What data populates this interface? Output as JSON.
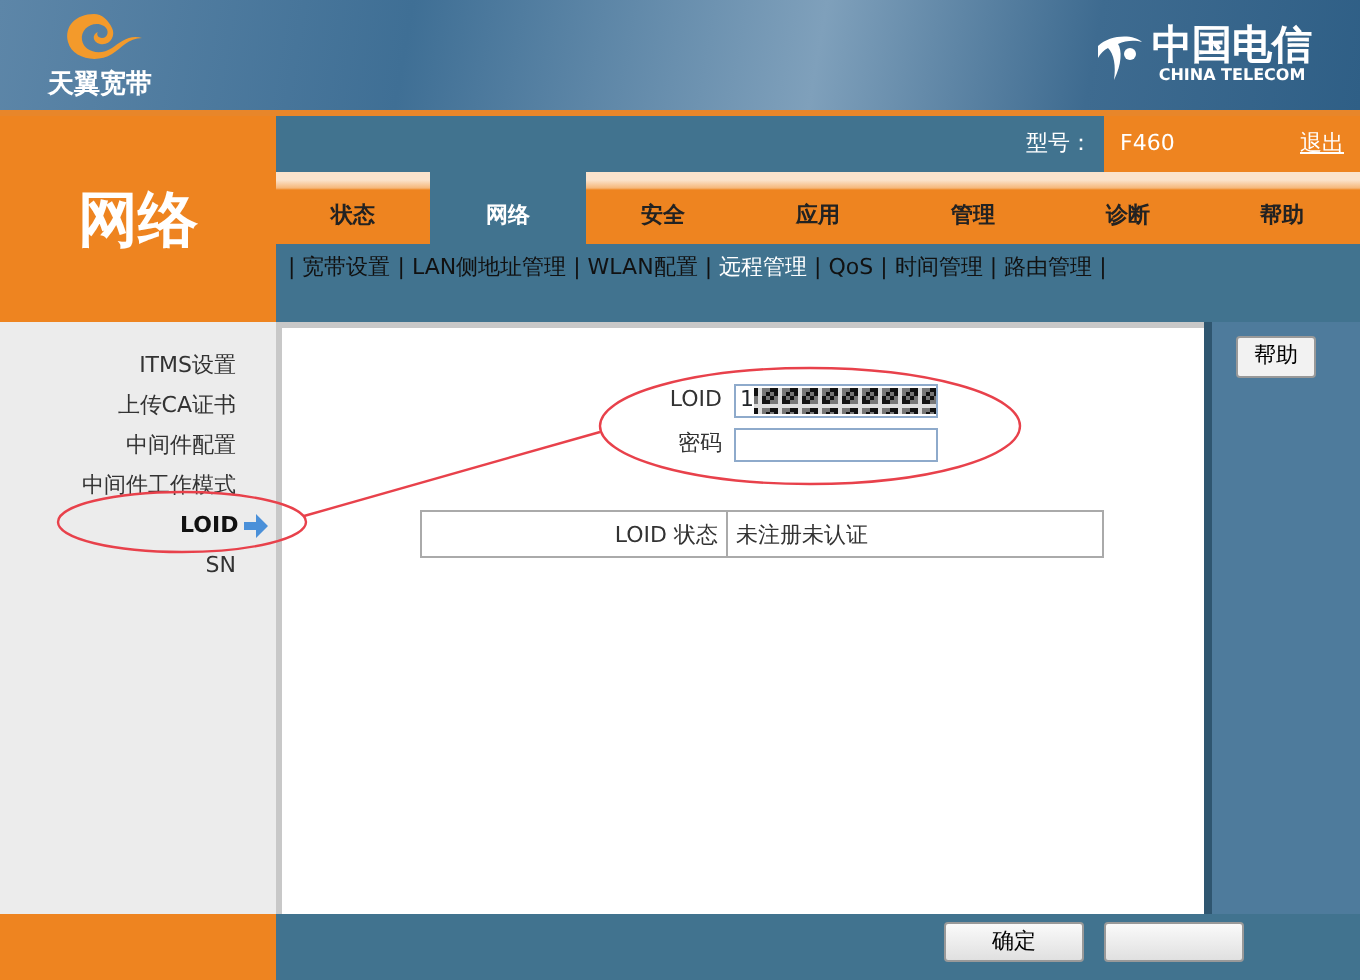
{
  "header": {
    "brand": "天翼宽带",
    "logo_cn": "中国电信",
    "logo_en": "CHINA TELECOM"
  },
  "section_title": "网络",
  "model": {
    "label": "型号：",
    "value": "F460"
  },
  "logout": "退出",
  "tabs": [
    {
      "label": "状态",
      "selected": false
    },
    {
      "label": "网络",
      "selected": true
    },
    {
      "label": "安全",
      "selected": false
    },
    {
      "label": "应用",
      "selected": false
    },
    {
      "label": "管理",
      "selected": false
    },
    {
      "label": "诊断",
      "selected": false
    },
    {
      "label": "帮助",
      "selected": false
    }
  ],
  "subnav_separator": "|",
  "subnav": [
    {
      "label": "宽带设置",
      "selected": false
    },
    {
      "label": "LAN侧地址管理",
      "selected": false
    },
    {
      "label": "WLAN配置",
      "selected": false
    },
    {
      "label": "远程管理",
      "selected": true
    },
    {
      "label": "QoS",
      "selected": false
    },
    {
      "label": "时间管理",
      "selected": false
    },
    {
      "label": "路由管理",
      "selected": false
    }
  ],
  "sidebar": {
    "items": [
      {
        "label": "ITMS设置",
        "selected": false
      },
      {
        "label": "上传CA证书",
        "selected": false
      },
      {
        "label": "中间件配置",
        "selected": false
      },
      {
        "label": "中间件工作模式",
        "selected": false
      },
      {
        "label": "LOID",
        "selected": true
      },
      {
        "label": "SN",
        "selected": false
      }
    ]
  },
  "form": {
    "fields": [
      {
        "label": "LOID",
        "value": "1",
        "redacted": true
      },
      {
        "label": "密码",
        "redacted": false
      }
    ]
  },
  "status_table": {
    "rows": [
      {
        "label": "LOID 状态",
        "value": "未注册未认证"
      }
    ]
  },
  "help_button": "帮助",
  "footer_buttons": [
    {
      "kind": "labeled",
      "label": "确定"
    },
    {
      "kind": "blank"
    }
  ]
}
